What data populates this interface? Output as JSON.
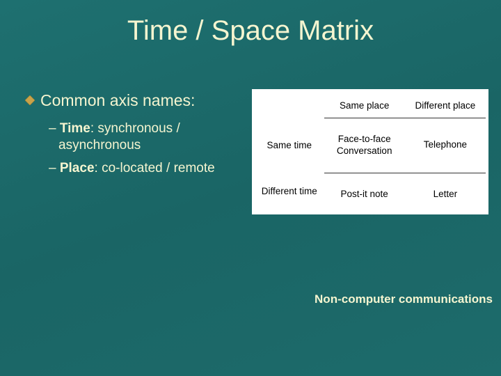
{
  "title": "Time / Space Matrix",
  "bullet": {
    "heading": "Common axis names:",
    "items": [
      {
        "label": "Time",
        "desc": ":  synchronous / asynchronous"
      },
      {
        "label": "Place",
        "desc": ":  co-located / remote"
      }
    ]
  },
  "matrix": {
    "col_headers": [
      "Same place",
      "Different place"
    ],
    "row_headers": [
      "Same time",
      "Different time"
    ],
    "cells": [
      [
        "Face-to-face Conversation",
        "Telephone"
      ],
      [
        "Post-it note",
        "Letter"
      ]
    ]
  },
  "caption": "Non-computer communications",
  "icons": {
    "bullet": "diamond-bullet-icon"
  },
  "colors": {
    "bg": "#1a6b6b",
    "text": "#f5f5d0",
    "bullet": "#c9a24a"
  },
  "chart_data": {
    "type": "table",
    "title": "Time / Space Matrix",
    "col_labels": [
      "Same place",
      "Different place"
    ],
    "row_labels": [
      "Same time",
      "Different time"
    ],
    "values": [
      [
        "Face-to-face Conversation",
        "Telephone"
      ],
      [
        "Post-it note",
        "Letter"
      ]
    ],
    "caption": "Non-computer communications"
  }
}
